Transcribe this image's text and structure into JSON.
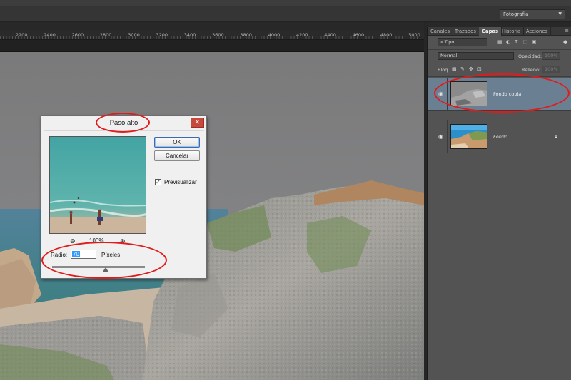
{
  "app": {
    "workspace": "Fotografía",
    "ruler_labels": [
      "2200",
      "2400",
      "2600",
      "2800",
      "3000",
      "3200",
      "3400",
      "3600",
      "3800",
      "4000",
      "4200",
      "4400",
      "4600",
      "4800",
      "5000"
    ]
  },
  "panel": {
    "tabs": [
      "Canales",
      "Trazados",
      "Capas",
      "Historia",
      "Acciones"
    ],
    "active_tab": "Capas",
    "filter_kind": "Tipo",
    "blend_mode": "Normal",
    "opacity_label": "Opacidad:",
    "opacity_value": "100%",
    "lock_label": "Bloq.:",
    "fill_label": "Relleno:",
    "fill_value": "100%",
    "layers": [
      {
        "name": "Fondo copia",
        "selected": true,
        "visible": true
      },
      {
        "name": "Fondo",
        "selected": false,
        "visible": true,
        "locked": true
      }
    ]
  },
  "dialog": {
    "title": "Paso alto",
    "ok_label": "OK",
    "cancel_label": "Cancelar",
    "preview_label": "Previsualizar",
    "preview_checked": true,
    "zoom": "100%",
    "radius_label": "Radio:",
    "radius_value": "70",
    "radius_unit": "Píxeles",
    "slider_fraction": 0.58
  },
  "colors": {
    "annotation": "#e11b1b",
    "selected_layer": "#6b7f93"
  }
}
